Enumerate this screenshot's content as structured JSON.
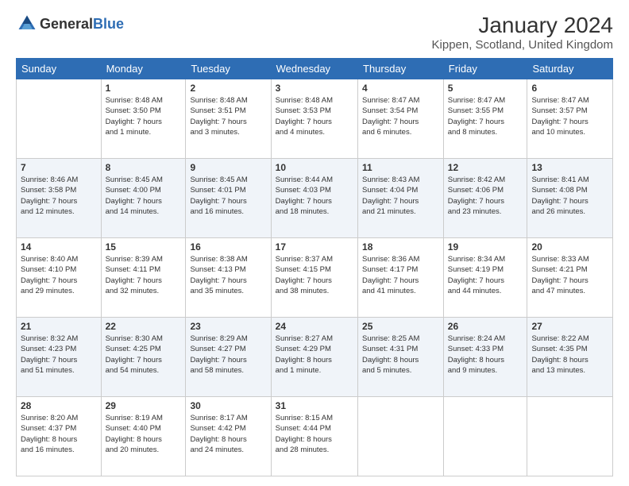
{
  "logo": {
    "text_general": "General",
    "text_blue": "Blue"
  },
  "header": {
    "title": "January 2024",
    "subtitle": "Kippen, Scotland, United Kingdom"
  },
  "weekdays": [
    "Sunday",
    "Monday",
    "Tuesday",
    "Wednesday",
    "Thursday",
    "Friday",
    "Saturday"
  ],
  "weeks": [
    [
      {
        "day": "",
        "info": ""
      },
      {
        "day": "1",
        "info": "Sunrise: 8:48 AM\nSunset: 3:50 PM\nDaylight: 7 hours\nand 1 minute."
      },
      {
        "day": "2",
        "info": "Sunrise: 8:48 AM\nSunset: 3:51 PM\nDaylight: 7 hours\nand 3 minutes."
      },
      {
        "day": "3",
        "info": "Sunrise: 8:48 AM\nSunset: 3:53 PM\nDaylight: 7 hours\nand 4 minutes."
      },
      {
        "day": "4",
        "info": "Sunrise: 8:47 AM\nSunset: 3:54 PM\nDaylight: 7 hours\nand 6 minutes."
      },
      {
        "day": "5",
        "info": "Sunrise: 8:47 AM\nSunset: 3:55 PM\nDaylight: 7 hours\nand 8 minutes."
      },
      {
        "day": "6",
        "info": "Sunrise: 8:47 AM\nSunset: 3:57 PM\nDaylight: 7 hours\nand 10 minutes."
      }
    ],
    [
      {
        "day": "7",
        "info": "Sunrise: 8:46 AM\nSunset: 3:58 PM\nDaylight: 7 hours\nand 12 minutes."
      },
      {
        "day": "8",
        "info": "Sunrise: 8:45 AM\nSunset: 4:00 PM\nDaylight: 7 hours\nand 14 minutes."
      },
      {
        "day": "9",
        "info": "Sunrise: 8:45 AM\nSunset: 4:01 PM\nDaylight: 7 hours\nand 16 minutes."
      },
      {
        "day": "10",
        "info": "Sunrise: 8:44 AM\nSunset: 4:03 PM\nDaylight: 7 hours\nand 18 minutes."
      },
      {
        "day": "11",
        "info": "Sunrise: 8:43 AM\nSunset: 4:04 PM\nDaylight: 7 hours\nand 21 minutes."
      },
      {
        "day": "12",
        "info": "Sunrise: 8:42 AM\nSunset: 4:06 PM\nDaylight: 7 hours\nand 23 minutes."
      },
      {
        "day": "13",
        "info": "Sunrise: 8:41 AM\nSunset: 4:08 PM\nDaylight: 7 hours\nand 26 minutes."
      }
    ],
    [
      {
        "day": "14",
        "info": "Sunrise: 8:40 AM\nSunset: 4:10 PM\nDaylight: 7 hours\nand 29 minutes."
      },
      {
        "day": "15",
        "info": "Sunrise: 8:39 AM\nSunset: 4:11 PM\nDaylight: 7 hours\nand 32 minutes."
      },
      {
        "day": "16",
        "info": "Sunrise: 8:38 AM\nSunset: 4:13 PM\nDaylight: 7 hours\nand 35 minutes."
      },
      {
        "day": "17",
        "info": "Sunrise: 8:37 AM\nSunset: 4:15 PM\nDaylight: 7 hours\nand 38 minutes."
      },
      {
        "day": "18",
        "info": "Sunrise: 8:36 AM\nSunset: 4:17 PM\nDaylight: 7 hours\nand 41 minutes."
      },
      {
        "day": "19",
        "info": "Sunrise: 8:34 AM\nSunset: 4:19 PM\nDaylight: 7 hours\nand 44 minutes."
      },
      {
        "day": "20",
        "info": "Sunrise: 8:33 AM\nSunset: 4:21 PM\nDaylight: 7 hours\nand 47 minutes."
      }
    ],
    [
      {
        "day": "21",
        "info": "Sunrise: 8:32 AM\nSunset: 4:23 PM\nDaylight: 7 hours\nand 51 minutes."
      },
      {
        "day": "22",
        "info": "Sunrise: 8:30 AM\nSunset: 4:25 PM\nDaylight: 7 hours\nand 54 minutes."
      },
      {
        "day": "23",
        "info": "Sunrise: 8:29 AM\nSunset: 4:27 PM\nDaylight: 7 hours\nand 58 minutes."
      },
      {
        "day": "24",
        "info": "Sunrise: 8:27 AM\nSunset: 4:29 PM\nDaylight: 8 hours\nand 1 minute."
      },
      {
        "day": "25",
        "info": "Sunrise: 8:25 AM\nSunset: 4:31 PM\nDaylight: 8 hours\nand 5 minutes."
      },
      {
        "day": "26",
        "info": "Sunrise: 8:24 AM\nSunset: 4:33 PM\nDaylight: 8 hours\nand 9 minutes."
      },
      {
        "day": "27",
        "info": "Sunrise: 8:22 AM\nSunset: 4:35 PM\nDaylight: 8 hours\nand 13 minutes."
      }
    ],
    [
      {
        "day": "28",
        "info": "Sunrise: 8:20 AM\nSunset: 4:37 PM\nDaylight: 8 hours\nand 16 minutes."
      },
      {
        "day": "29",
        "info": "Sunrise: 8:19 AM\nSunset: 4:40 PM\nDaylight: 8 hours\nand 20 minutes."
      },
      {
        "day": "30",
        "info": "Sunrise: 8:17 AM\nSunset: 4:42 PM\nDaylight: 8 hours\nand 24 minutes."
      },
      {
        "day": "31",
        "info": "Sunrise: 8:15 AM\nSunset: 4:44 PM\nDaylight: 8 hours\nand 28 minutes."
      },
      {
        "day": "",
        "info": ""
      },
      {
        "day": "",
        "info": ""
      },
      {
        "day": "",
        "info": ""
      }
    ]
  ]
}
